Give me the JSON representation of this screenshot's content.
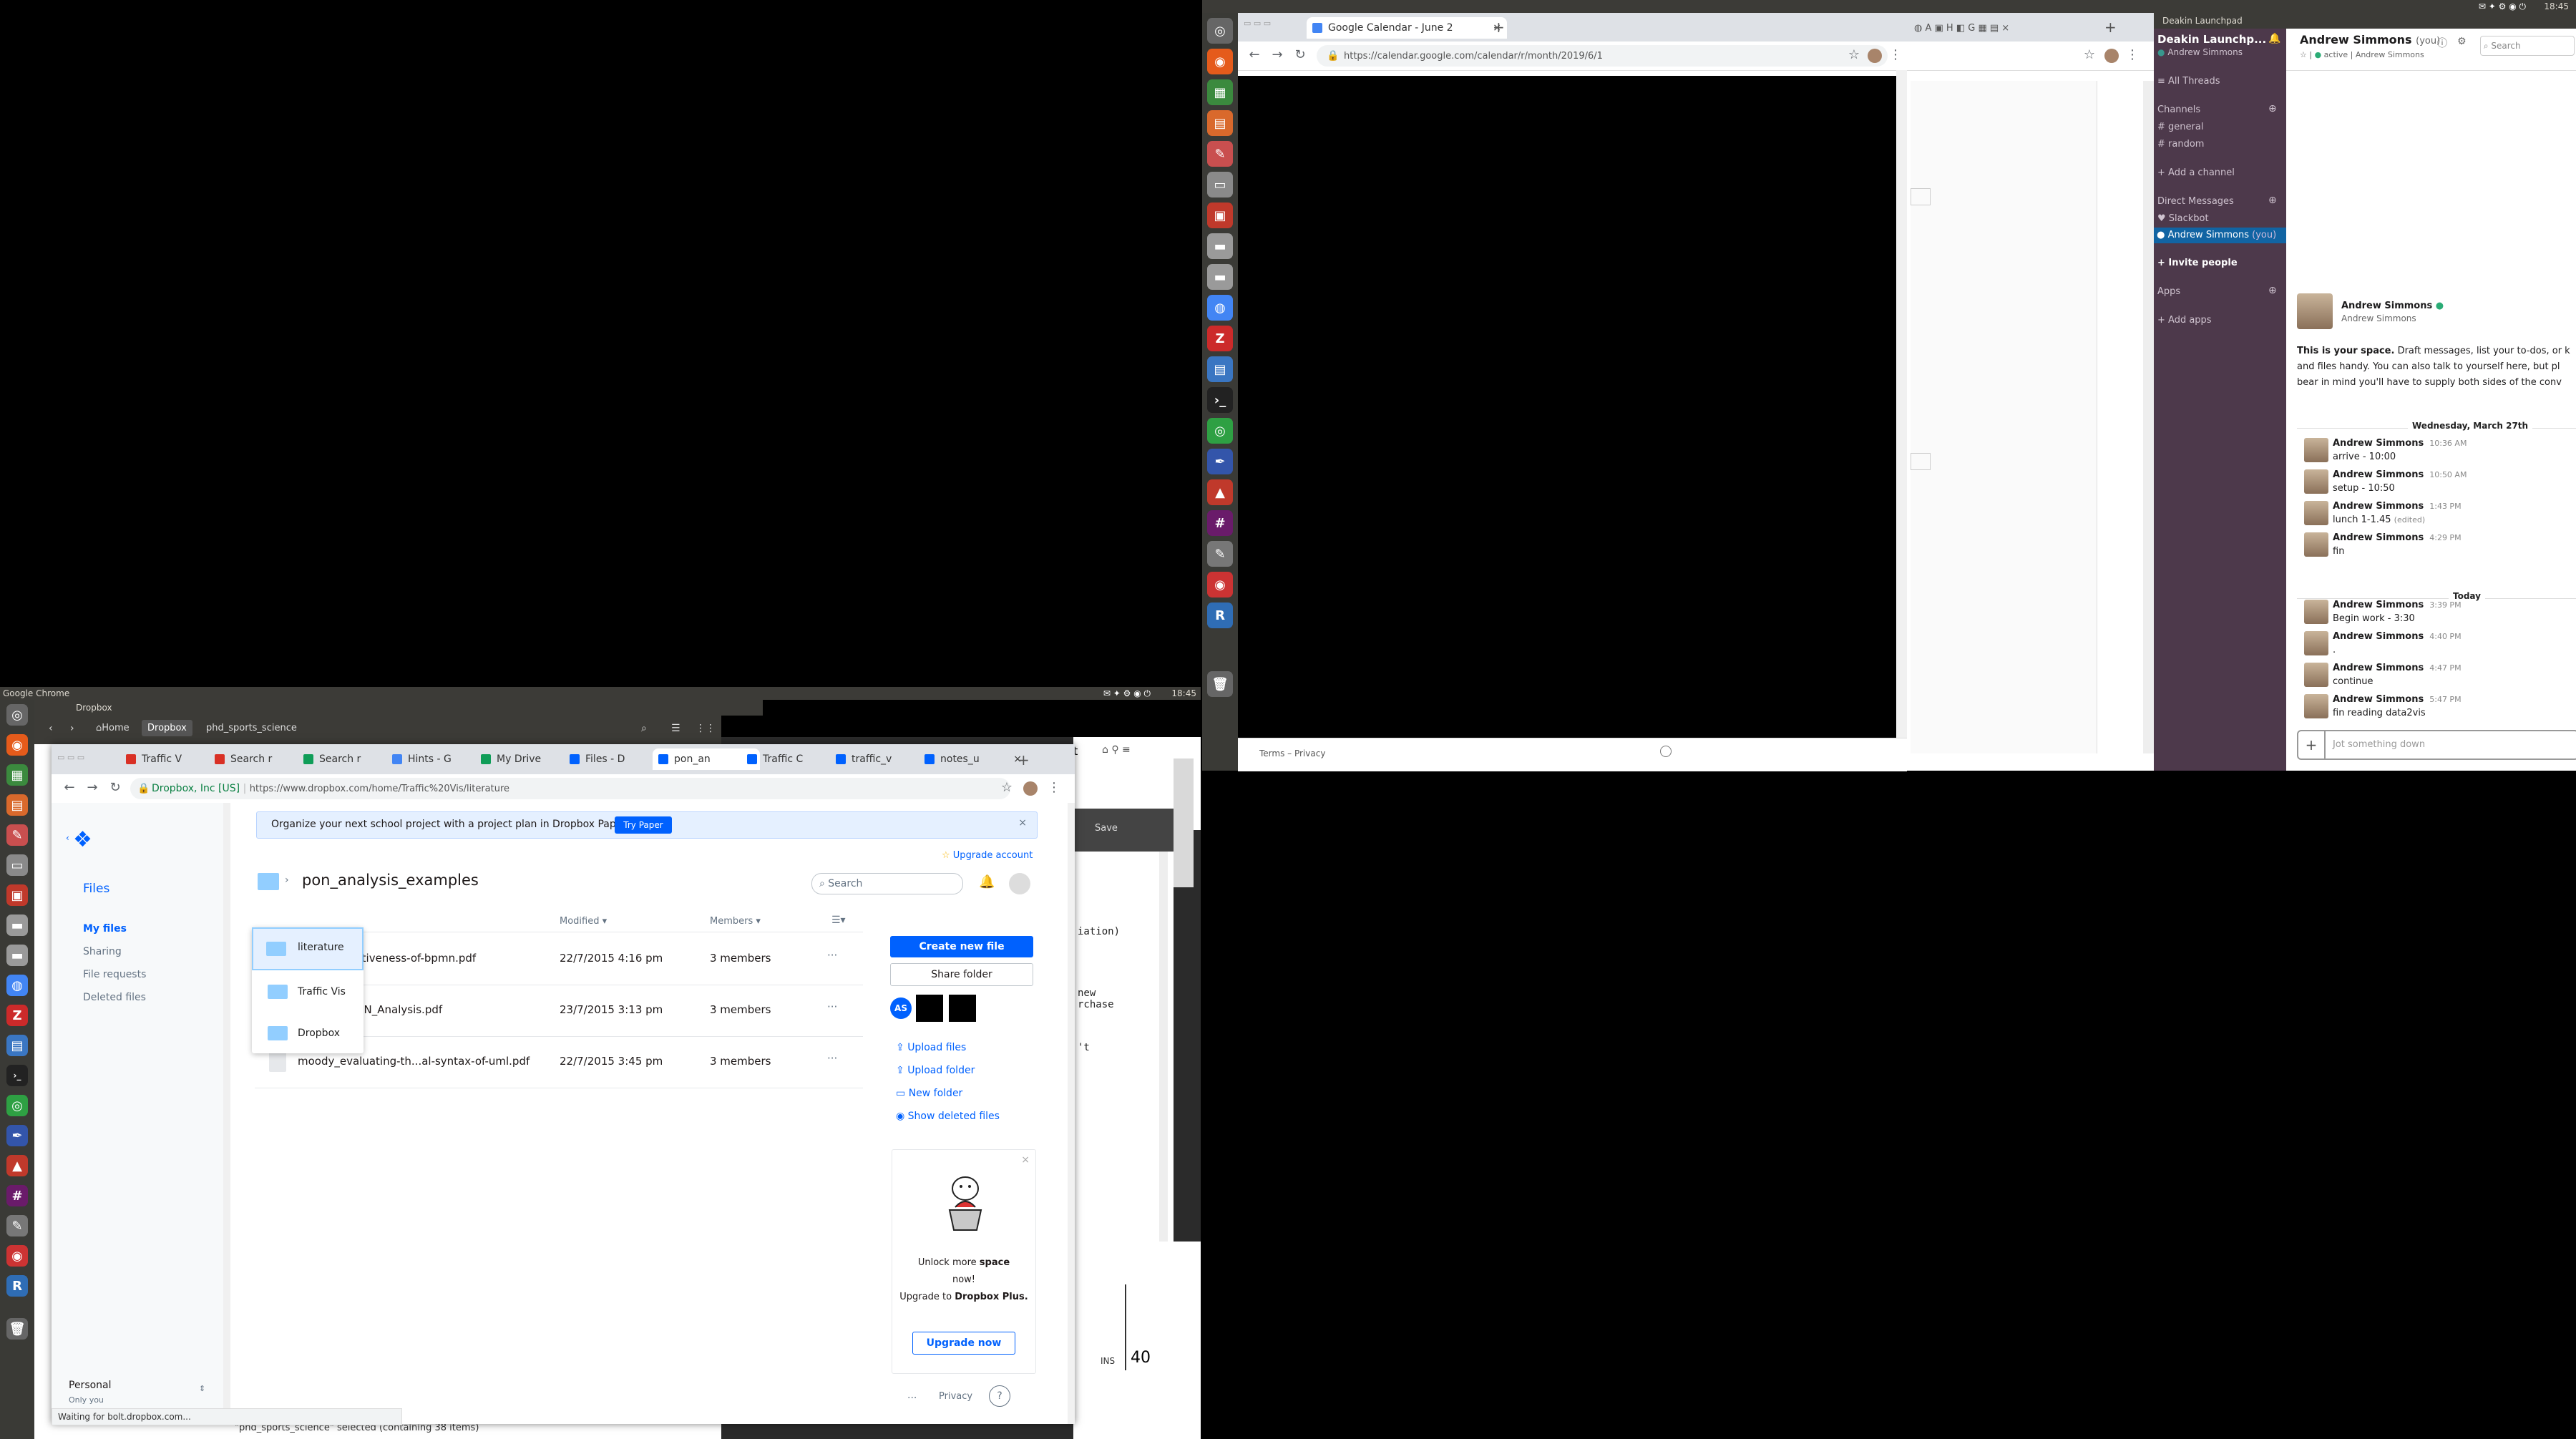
{
  "system": {
    "clock_right": "18:45",
    "clock_left": "18:45",
    "left_window_title": "Google Chrome",
    "slack_window_title": "Deakin Launchpad",
    "left_time_widget": "18:45"
  },
  "calendar_chrome": {
    "tab_title": "Google Calendar - June 2",
    "url": "https://calendar.google.com/calendar/r/month/2019/6/1",
    "footer": "Terms – Privacy"
  },
  "nautilus": {
    "title": "Dropbox",
    "crumb_home": "Home",
    "crumb_dropbox": "Dropbox",
    "crumb_folder": "phd_sports_science",
    "status": "\"phd_sports_science\" selected  (containing 38 items)"
  },
  "dropbox_chrome": {
    "tabs": [
      {
        "label": "Traffic V",
        "icon": "gmail-icon"
      },
      {
        "label": "Search r",
        "icon": "gmail-icon"
      },
      {
        "label": "Search r",
        "icon": "drive-icon"
      },
      {
        "label": "Hints - G",
        "icon": "doc-icon"
      },
      {
        "label": "My Drive",
        "icon": "drive-icon"
      },
      {
        "label": "Files - D",
        "icon": "dropbox-icon"
      },
      {
        "label": "pon_an",
        "icon": "dropbox-icon"
      },
      {
        "label": "Traffic C",
        "icon": "dropbox-icon"
      },
      {
        "label": "traffic_v",
        "icon": "dropbox-icon"
      },
      {
        "label": "notes_u",
        "icon": "dropbox-icon"
      }
    ],
    "site_info": "Dropbox, Inc [US]",
    "url": "https://www.dropbox.com/home/Traffic%20Vis/literature",
    "status": "Waiting for bolt.dropbox.com..."
  },
  "dropbox": {
    "banner_text": "Organize your next school project with a project plan in Dropbox Paper.",
    "banner_button": "Try Paper",
    "upgrade_account": "Upgrade account",
    "nav_title": "Files",
    "nav_items": [
      "My files",
      "Sharing",
      "File requests",
      "Deleted files"
    ],
    "account_name": "Personal",
    "account_sub": "Only you",
    "folder_title": "pon_analysis_examples",
    "search_placeholder": "Search",
    "col_modified": "Modified",
    "col_members": "Members",
    "files": [
      {
        "name": "...sing-the...tiveness-of-bpmn.pdf",
        "modified": "22/7/2015 4:16 pm",
        "members": "3 members"
      },
      {
        "name": "...BPMN2_PoN_Analysis.pdf",
        "modified": "23/7/2015 3:13 pm",
        "members": "3 members"
      },
      {
        "name": "moody_evaluating-th...al-syntax-of-uml.pdf",
        "modified": "22/7/2015 3:45 pm",
        "members": "3 members"
      }
    ],
    "dropdown": [
      "literature",
      "Traffic Vis",
      "Dropbox"
    ],
    "create_button": "Create new file",
    "share_button": "Share folder",
    "member_initials": "AS",
    "actions": [
      "Upload files",
      "Upload folder",
      "New folder",
      "Show deleted files"
    ],
    "promo_line1": "Unlock more",
    "promo_bold": "space",
    "promo_line2": "now!",
    "promo_line3": "Upgrade to",
    "promo_bold2": "Dropbox Plus.",
    "promo_button": "Upgrade now",
    "footer_more": "...",
    "footer_privacy": "Privacy",
    "footer_help": "?"
  },
  "behind_editor": {
    "save": "Save",
    "lines": [
      "iation)",
      "new",
      "rchase",
      "'t"
    ],
    "ins": "INS",
    "number": "40"
  },
  "slack": {
    "workspace": "Deakin Launchp...",
    "user": "Andrew Simmons",
    "all_threads": "All Threads",
    "channels_header": "Channels",
    "channels": [
      "general",
      "random"
    ],
    "add_channel": "Add a channel",
    "dm_header": "Direct Messages",
    "dms": [
      "Slackbot",
      "Andrew Simmons"
    ],
    "you_tag": "(you)",
    "invite": "Invite people",
    "apps_header": "Apps",
    "add_apps": "Add apps",
    "chan_title": "Andrew Simmons",
    "chan_you": "(you)",
    "chan_status": "active",
    "chan_sub": "Andrew Simmons",
    "search_placeholder": "Search",
    "intro_name": "Andrew Simmons",
    "intro_sub": "Andrew Simmons",
    "intro_bold": "This is your space.",
    "intro_text1": "Draft messages, list your to-dos, or k",
    "intro_text2": "and files handy. You can also talk to yourself here, but pl",
    "intro_text3": "bear in mind you'll have to supply both sides of the conv",
    "date1": "Wednesday, March 27th",
    "date2": "Today",
    "messages": [
      {
        "name": "Andrew Simmons",
        "time": "10:36 AM",
        "text": "arrive - 10:00"
      },
      {
        "name": "Andrew Simmons",
        "time": "10:50 AM",
        "text": "setup - 10:50"
      },
      {
        "name": "Andrew Simmons",
        "time": "1:43 PM",
        "text": "lunch 1-1.45",
        "edited": "(edited)"
      },
      {
        "name": "Andrew Simmons",
        "time": "4:29 PM",
        "text": "fin"
      },
      {
        "name": "Andrew Simmons",
        "time": "3:39 PM",
        "text": "Begin work - 3:30"
      },
      {
        "name": "Andrew Simmons",
        "time": "4:40 PM",
        "text": "."
      },
      {
        "name": "Andrew Simmons",
        "time": "4:47 PM",
        "text": "continue"
      },
      {
        "name": "Andrew Simmons",
        "time": "5:47 PM",
        "text": "fin reading data2vis"
      }
    ],
    "composer_placeholder": "Jot something down"
  },
  "colors": {
    "dropbox_blue": "#0061fe",
    "slack_sidebar": "#4d394b",
    "slack_active": "#1164a3",
    "ubuntu_panel": "#3c3b37"
  }
}
